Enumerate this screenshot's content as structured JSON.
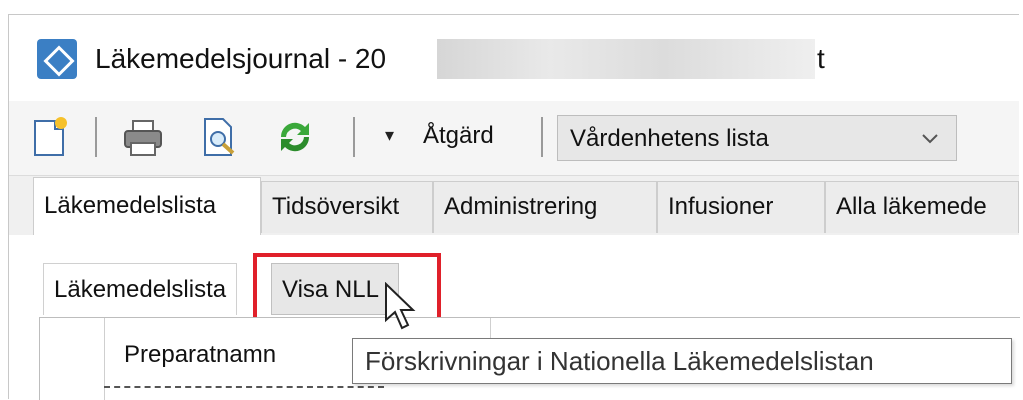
{
  "window": {
    "title": "Läkemedelsjournal - 20",
    "title_tail": "t"
  },
  "toolbar": {
    "icons": [
      "new-document-icon",
      "print-icon",
      "print-preview-icon",
      "refresh-icon"
    ],
    "action_label": "Åtgärd",
    "list_select": {
      "selected": "Vårdenhetens lista"
    }
  },
  "tabs": [
    {
      "label": "Läkemedelslista",
      "active": true
    },
    {
      "label": "Tidsöversikt"
    },
    {
      "label": "Administrering"
    },
    {
      "label": "Infusioner"
    },
    {
      "label": "Alla läkemede"
    }
  ],
  "subtabs": [
    {
      "label": "Läkemedelslista"
    },
    {
      "label": "Visa NLL"
    }
  ],
  "grid": {
    "column_header": "Preparatnamn"
  },
  "tooltip": "Förskrivningar i Nationella Läkemedelslistan",
  "colors": {
    "highlight": "#e0202a",
    "accent": "#3b7fc4"
  }
}
